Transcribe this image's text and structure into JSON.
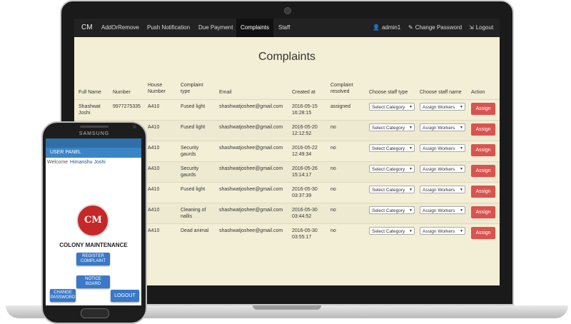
{
  "navbar": {
    "brand": "CM",
    "items": [
      "AddOrRemove",
      "Push Notification",
      "Due Payment",
      "Complaints",
      "Staff"
    ],
    "active": "Complaints",
    "right": {
      "user": "admin1",
      "change_password": "Change Password",
      "logout": "Logout"
    }
  },
  "page": {
    "title": "Complaints"
  },
  "table": {
    "headers": {
      "full_name": "Full Name",
      "number": "Number",
      "house_number": [
        "House",
        "Number"
      ],
      "complaint_type": [
        "Complaint",
        "type"
      ],
      "email": "Email",
      "created_at": "Created at",
      "complaint_resolved": [
        "Complaint",
        "resolved"
      ],
      "staff_type": "Choose staff type",
      "staff_name": "Choose staff name",
      "action": "Action"
    },
    "select_category": "Select Category",
    "assign_workers": "Assign Workers",
    "assign_label": "Assign",
    "rows": [
      {
        "name": [
          "Shashwat",
          "Joshi"
        ],
        "number": "9977275335",
        "house": "A410",
        "type": [
          "Fused light",
          ""
        ],
        "email": "shashwatjoshee@gmail.com",
        "date": "2016-05-15",
        "time": "16:28:15",
        "resolved": "assigned"
      },
      {
        "name": [
          "",
          ""
        ],
        "number": "",
        "house": "A410",
        "type": [
          "Fused light",
          ""
        ],
        "email": "shashwatjoshee@gmail.com",
        "date": "2016-05-20",
        "time": "12:12:52",
        "resolved": "no"
      },
      {
        "name": [
          "",
          ""
        ],
        "number": "",
        "house": "A410",
        "type": [
          "Security",
          "gaurds"
        ],
        "email": "shashwatjoshee@gmail.com",
        "date": "2016-05-22",
        "time": "12:49:34",
        "resolved": "no"
      },
      {
        "name": [
          "",
          ""
        ],
        "number": "",
        "house": "A410",
        "type": [
          "Security",
          "gaurds"
        ],
        "email": "shashwatjoshee@gmail.com",
        "date": "2016-05-26",
        "time": "15:14:17",
        "resolved": "no"
      },
      {
        "name": [
          "",
          ""
        ],
        "number": "",
        "house": "A410",
        "type": [
          "Fused light",
          ""
        ],
        "email": "shashwatjoshee@gmail.com",
        "date": "2016-05-30",
        "time": "03:37:39",
        "resolved": "no"
      },
      {
        "name": [
          "",
          ""
        ],
        "number": "",
        "house": "A410",
        "type": [
          "Cleaning of",
          "nallis"
        ],
        "email": "shashwatjoshee@gmail.com",
        "date": "2016-05-30",
        "time": "03:44:52",
        "resolved": "no"
      },
      {
        "name": [
          "",
          ""
        ],
        "number": "",
        "house": "A410",
        "type": [
          "Dead animal",
          ""
        ],
        "email": "shashwatjoshee@gmail.com",
        "date": "2016-05-30",
        "time": "03:55:17",
        "resolved": "no"
      }
    ]
  },
  "phone": {
    "brand": "SAMSUNG",
    "panel_title": "USER PANEL",
    "welcome": "Welcome",
    "user_name": "Himanshu Joshi",
    "logo_text": "CM",
    "app_title": "COLONY MAINTENANCE",
    "buttons": {
      "register": [
        "REGISTER",
        "COMPLAINT"
      ],
      "notice": [
        "NOTICE",
        "BOARD"
      ],
      "change_password": [
        "CHANGE",
        "PASSWORD"
      ],
      "logout": "LOGOUT"
    }
  },
  "colors": {
    "navbar": "#222222",
    "page_bg": "#f3efd6",
    "assign_button": "#d9534f",
    "phone_button": "#3a78c8",
    "panel_bar": "#3a85c6"
  },
  "icons": {
    "user": "user-icon",
    "change_password": "edit-icon",
    "logout": "logout-icon"
  }
}
